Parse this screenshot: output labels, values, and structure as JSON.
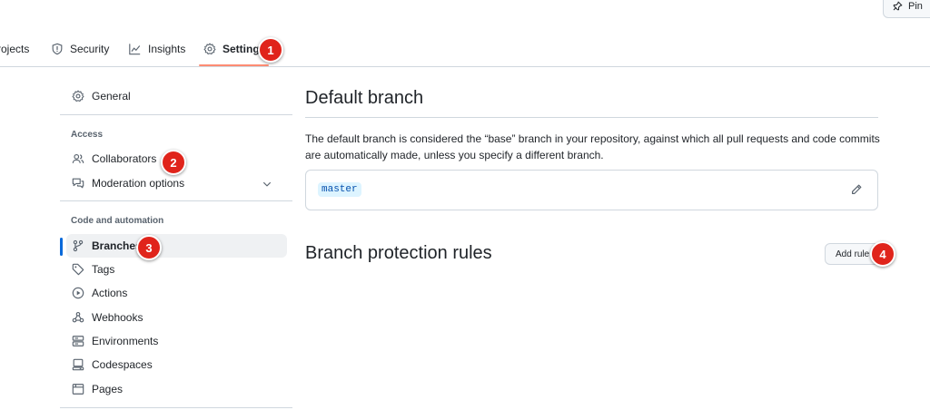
{
  "pin": {
    "label": "Pin"
  },
  "topnav": {
    "tabs": [
      {
        "label": "rojects",
        "icon": "project-icon"
      },
      {
        "label": "Security",
        "icon": "shield-icon"
      },
      {
        "label": "Insights",
        "icon": "graph-icon"
      },
      {
        "label": "Settings",
        "icon": "gear-icon",
        "selected": true
      }
    ]
  },
  "sidebar": {
    "general": "General",
    "access_heading": "Access",
    "collaborators": "Collaborators",
    "moderation": "Moderation options",
    "code_heading": "Code and automation",
    "items": [
      {
        "label": "Branches",
        "icon": "git-branch-icon",
        "active": true
      },
      {
        "label": "Tags",
        "icon": "tag-icon"
      },
      {
        "label": "Actions",
        "icon": "play-icon"
      },
      {
        "label": "Webhooks",
        "icon": "webhook-icon"
      },
      {
        "label": "Environments",
        "icon": "server-icon"
      },
      {
        "label": "Codespaces",
        "icon": "codespaces-icon"
      },
      {
        "label": "Pages",
        "icon": "browser-icon"
      }
    ]
  },
  "main": {
    "default_branch_title": "Default branch",
    "default_branch_desc": "The default branch is considered the “base” branch in your repository, against which all pull requests and code commits are automatically made, unless you specify a different branch.",
    "branch_name": "master",
    "protection_title": "Branch protection rules",
    "add_rule": "Add rule"
  },
  "callouts": [
    "1",
    "2",
    "3",
    "4"
  ],
  "colors": {
    "accent": "#0969da",
    "callout": "#e0241b",
    "tab_underline": "#fd8c73",
    "code_bg": "#ddf4ff"
  }
}
